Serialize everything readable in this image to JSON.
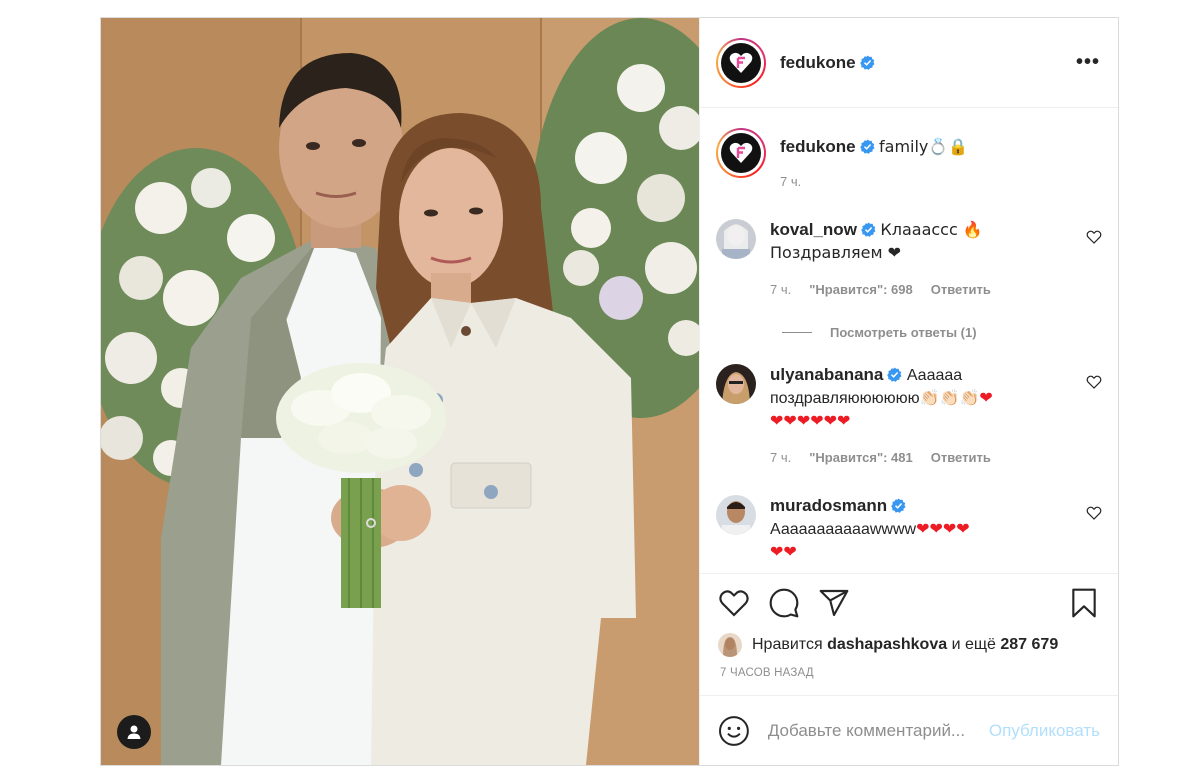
{
  "post": {
    "author": "fedukone",
    "more_icon": "•••",
    "caption_text": "family💍🔒",
    "caption_time": "7 ч."
  },
  "comments": [
    {
      "user": "koval_now",
      "text": "Клааассс 🔥 Поздравляем ❤",
      "time": "7 ч.",
      "likes": "\"Нравится\": 698",
      "reply": "Ответить",
      "view_replies": "Посмотреть ответы (1)"
    },
    {
      "user": "ulyanabanana",
      "text_part1": "Аааааа поздравляюююююю",
      "emoji1": "👏🏻👏🏻👏🏻",
      "emoji2": "❤",
      "emoji_line2": "❤❤❤❤❤❤",
      "time": "7 ч.",
      "likes": "\"Нравится\": 481",
      "reply": "Ответить"
    },
    {
      "user": "muradosmann",
      "text": "Аааааааааааwwww",
      "emoji": "❤❤❤❤",
      "emoji_line2": "❤❤"
    }
  ],
  "likes": {
    "prefix": "Нравится",
    "user": "dashapashkova",
    "middle": "и ещё",
    "count": "287 679"
  },
  "time_ago": "7 ЧАСОВ НАЗАД",
  "comment_box": {
    "placeholder": "Добавьте комментарий...",
    "publish_label": "Опубликовать"
  },
  "colors": {
    "verified": "#3897f0",
    "publish": "#b2dffc",
    "heart": "#ed1c24"
  }
}
